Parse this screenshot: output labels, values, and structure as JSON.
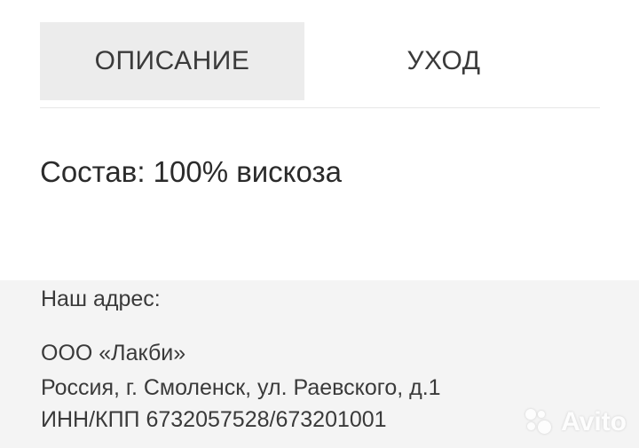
{
  "tabs": [
    {
      "label": "ОПИСАНИЕ",
      "active": true
    },
    {
      "label": "УХОД",
      "active": false
    }
  ],
  "composition": "Состав: 100% вискоза",
  "address": {
    "title": "Наш адрес:",
    "lines": [
      "ООО «Лакби»",
      "Россия, г. Смоленск, ул. Раевского, д.1",
      "ИНН/КПП 6732057528/673201001"
    ]
  },
  "watermark": {
    "text": "Avito",
    "icon": "avito-dots-icon"
  },
  "colors": {
    "active_tab_bg": "#ececec",
    "footer_bg": "#f4f4f4",
    "text": "#2b2b2b"
  }
}
